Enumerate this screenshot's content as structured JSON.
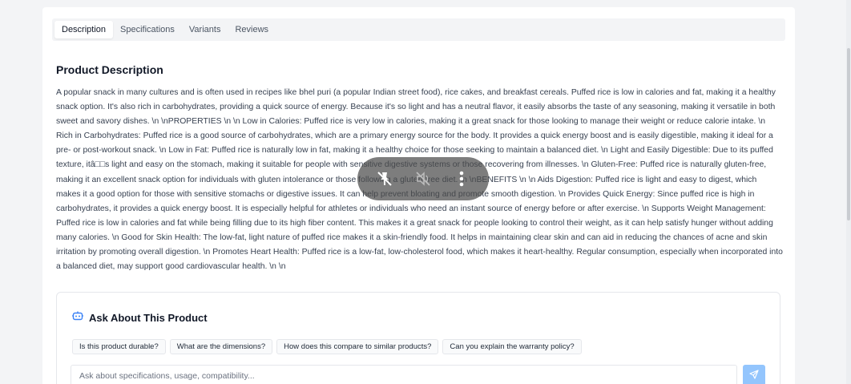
{
  "tabs": [
    {
      "label": "Description",
      "active": true
    },
    {
      "label": "Specifications",
      "active": false
    },
    {
      "label": "Variants",
      "active": false
    },
    {
      "label": "Reviews",
      "active": false
    }
  ],
  "product": {
    "heading": "Product Description",
    "description": "A popular snack in many cultures and is often used in recipes like bhel puri (a popular Indian street food), rice cakes, and breakfast cereals. Puffed rice is low in calories and fat, making it a healthy snack option. It's also rich in carbohydrates, providing a quick source of energy. Because it's so light and has a neutral flavor, it easily absorbs the taste of any seasoning, making it versatile in both sweet and savory dishes. \\n \\nPROPERTIES \\n \\n Low in Calories: Puffed rice is very low in calories, making it a great snack for those looking to manage their weight or reduce calorie intake. \\n Rich in Carbohydrates: Puffed rice is a good source of carbohydrates, which are a primary energy source for the body. It provides a quick energy boost and is easily digestible, making it ideal for a pre- or post-workout snack. \\n Low in Fat: Puffed rice is naturally low in fat, making it a healthy choice for those seeking to maintain a balanced diet. \\n Light and Easily Digestible: Due to its puffed texture, itâ□□s light and easy on the stomach, making it suitable for people with sensitive digestive systems or those recovering from illnesses. \\n Gluten-Free: Puffed rice is naturally gluten-free, making it an excellent snack option for individuals with gluten intolerance or those following a gluten-free diet. \\n \\nBENEFITS \\n \\n Aids Digestion: Puffed rice is light and easy to digest, which makes it a good option for those with sensitive stomachs or digestive issues. It can help prevent bloating and promote smooth digestion. \\n Provides Quick Energy: Since puffed rice is high in carbohydrates, it provides a quick energy boost. It is especially helpful for athletes or individuals who need an instant source of energy before or after exercise. \\n Supports Weight Management: Puffed rice is low in calories and fat while being filling due to its high fiber content. This makes it a great snack for people looking to control their weight, as it can help satisfy hunger without adding many calories. \\n Good for Skin Health: The low-fat, light nature of puffed rice makes it a skin-friendly food. It helps in maintaining clear skin and can aid in reducing the chances of acne and skin irritation by promoting overall digestion. \\n Promotes Heart Health: Puffed rice is a low-fat, low-cholesterol food, which makes it heart-healthy. Regular consumption, especially when incorporated into a balanced diet, may support good cardiovascular health. \\n \\n"
  },
  "ask": {
    "title": "Ask About This Product",
    "icon": "robot-icon",
    "suggestions": [
      "Is this product durable?",
      "What are the dimensions?",
      "How does this compare to similar products?",
      "Can you explain the warranty policy?"
    ],
    "placeholder": "Ask about specifications, usage, compatibility...",
    "send_icon": "send-icon"
  },
  "overlay_icons": [
    "pin-off-icon",
    "mute-icon",
    "more-icon"
  ],
  "colors": {
    "accent": "#93c5fd",
    "robot_icon": "#3b82f6",
    "page_bg": "#f3f4f6"
  }
}
